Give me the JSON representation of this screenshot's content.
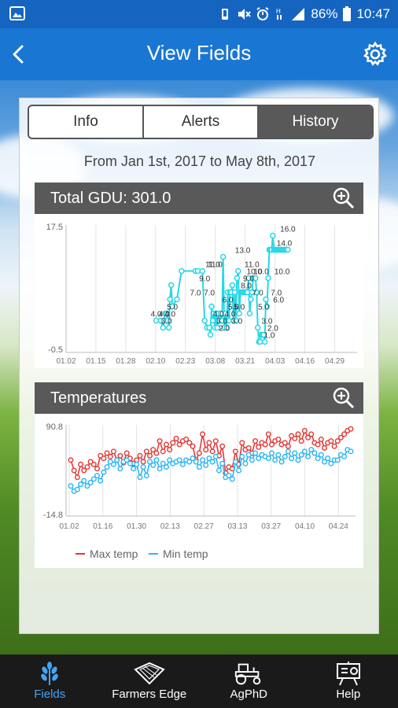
{
  "status_bar": {
    "battery": "86%",
    "time": "10:47"
  },
  "app_bar": {
    "title": "View Fields"
  },
  "tabs": [
    {
      "label": "Info"
    },
    {
      "label": "Alerts"
    },
    {
      "label": "History"
    }
  ],
  "date_range": "From Jan 1st, 2017 to May 8th, 2017",
  "gdu_card": {
    "title": "Total GDU: 301.0"
  },
  "temp_card": {
    "title": "Temperatures",
    "legend": [
      "Max temp",
      "Min temp"
    ]
  },
  "bottom_nav": [
    {
      "label": "Fields",
      "icon": "wheat-icon"
    },
    {
      "label": "Farmers Edge",
      "icon": "map-icon"
    },
    {
      "label": "AgPhD",
      "icon": "tractor-icon"
    },
    {
      "label": "Help",
      "icon": "help-board-icon"
    }
  ],
  "colors": {
    "app_bar": "#1976d2",
    "status_bar": "#1565c0",
    "card_header": "#595959",
    "gdu_line": "#26d7e8",
    "max_temp": "#e53935",
    "min_temp": "#29b6f6",
    "nav_active": "#42a5f5"
  },
  "chart_data": [
    {
      "type": "line",
      "ylim": [
        -0.5,
        17.5
      ],
      "y_tick_labels": [
        "17.5",
        "-0.5"
      ],
      "x_tick_labels": [
        "01.02",
        "01.15",
        "01.28",
        "02.10",
        "02.23",
        "03.08",
        "03.21",
        "04.03",
        "04.16",
        "04.29"
      ],
      "series": [
        {
          "x": [
            39.0,
            41.0,
            42.0,
            42.5,
            43.0,
            43.5,
            44.0,
            44.5,
            45.0,
            45.5,
            46.0,
            48.0,
            50.0,
            56.0,
            57.0,
            59.0,
            60.0,
            61.0,
            62.0,
            62.5,
            63.0,
            63.5,
            64.0,
            64.5,
            65.0,
            65.5,
            66.0,
            66.5,
            67.0,
            67.5,
            68.0,
            68.5,
            69.0,
            69.5,
            70.0,
            70.5,
            71.0,
            71.5,
            72.0,
            72.5,
            73.0,
            73.5,
            74.0,
            74.5,
            75.0,
            75.5,
            76.0,
            76.5,
            77.0,
            77.5,
            78.0,
            78.5,
            79.0,
            79.5,
            80.0,
            80.5,
            81.0,
            81.5,
            82.0,
            82.5,
            83.0,
            83.5,
            84.0,
            84.5,
            85.0,
            85.5,
            86.0,
            86.5,
            87.0,
            87.5,
            88.0,
            88.5,
            89.0,
            89.5,
            90.0,
            90.5,
            91.0,
            91.5,
            92.0,
            92.5,
            93.0,
            93.5,
            94.0,
            94.5,
            95.0,
            95.5,
            96.0
          ],
          "y": [
            4.0,
            4.0,
            3.0,
            4.0,
            5.0,
            5.0,
            4.0,
            3.0,
            7.0,
            9.0,
            6.0,
            7.0,
            11.0,
            11.0,
            11.0,
            11.0,
            4.0,
            3.0,
            3.0,
            2.0,
            6.0,
            4.0,
            5.0,
            3.0,
            5.0,
            3.0,
            5.0,
            4.0,
            5.0,
            4.0,
            13.0,
            3.0,
            5.0,
            3.0,
            8.0,
            4.0,
            8.0,
            8.0,
            9.0,
            4.0,
            8.0,
            4.0,
            10.0,
            11.0,
            5.0,
            8.0,
            8.0,
            8.0,
            8.0,
            8.0,
            8.0,
            8.0,
            10.0,
            5.0,
            7.0,
            8.0,
            10.0,
            10.0,
            10.0,
            8.0,
            3.0,
            1.0,
            1.0,
            2.0,
            2.0,
            2.0,
            1.0,
            7.0,
            6.0,
            10.0,
            14.0,
            14.0,
            14.0,
            16.0,
            14.0,
            14.0,
            14.0,
            14.0,
            14.0,
            14.0,
            14.0,
            14.0,
            14.0,
            14.0,
            14.0,
            14.0,
            14.0
          ]
        }
      ],
      "data_labels": [
        "4.0",
        "4.0",
        "3.0",
        "4.0",
        "5.0",
        "7.0",
        "9.0",
        "7.0",
        "11.0",
        "11.0",
        "4.0",
        "3.0",
        "2.0",
        "6.0",
        "4.0",
        "5.0",
        "3.0",
        "5.0",
        "13.0",
        "8.0",
        "9.0",
        "11.0",
        "10.0",
        "7.0",
        "10.0",
        "5.0",
        "3.0",
        "1.0",
        "2.0",
        "7.0",
        "6.0",
        "10.0",
        "14.0",
        "16.0"
      ]
    },
    {
      "type": "line",
      "ylim": [
        -14.8,
        90.8
      ],
      "y_tick_labels": [
        "90.8",
        "-14.8"
      ],
      "x_tick_labels": [
        "01.02",
        "01.16",
        "01.30",
        "02.13",
        "02.27",
        "03.13",
        "03.27",
        "04.10",
        "04.24"
      ],
      "series": [
        {
          "name": "Max temp",
          "y": [
            50,
            38,
            30,
            45,
            38,
            42,
            48,
            45,
            40,
            55,
            52,
            58,
            54,
            60,
            50,
            55,
            47,
            58,
            52,
            46,
            50,
            55,
            48,
            60,
            55,
            62,
            58,
            72,
            60,
            68,
            62,
            70,
            75,
            68,
            72,
            74,
            70,
            66,
            50,
            58,
            80,
            62,
            70,
            60,
            72,
            55,
            66,
            35,
            42,
            40,
            60,
            45,
            70,
            62,
            64,
            58,
            72,
            65,
            70,
            68,
            80,
            68,
            72,
            74,
            68,
            70,
            66,
            78,
            75,
            80,
            72,
            84,
            76,
            80,
            70,
            68,
            74,
            64,
            70,
            72,
            66,
            72,
            76,
            80,
            84,
            86
          ]
        },
        {
          "name": "Min temp",
          "y": [
            20,
            14,
            16,
            22,
            26,
            20,
            24,
            28,
            32,
            26,
            36,
            42,
            48,
            45,
            50,
            40,
            48,
            50,
            46,
            40,
            45,
            30,
            42,
            32,
            48,
            44,
            50,
            40,
            46,
            42,
            50,
            46,
            48,
            50,
            45,
            50,
            48,
            52,
            48,
            42,
            50,
            44,
            52,
            48,
            54,
            38,
            46,
            30,
            32,
            28,
            48,
            38,
            54,
            46,
            56,
            50,
            58,
            52,
            56,
            54,
            52,
            58,
            50,
            56,
            48,
            54,
            60,
            52,
            58,
            50,
            56,
            60,
            54,
            62,
            58,
            52,
            56,
            48,
            52,
            46,
            50,
            50,
            56,
            54,
            62,
            60
          ]
        }
      ]
    }
  ]
}
